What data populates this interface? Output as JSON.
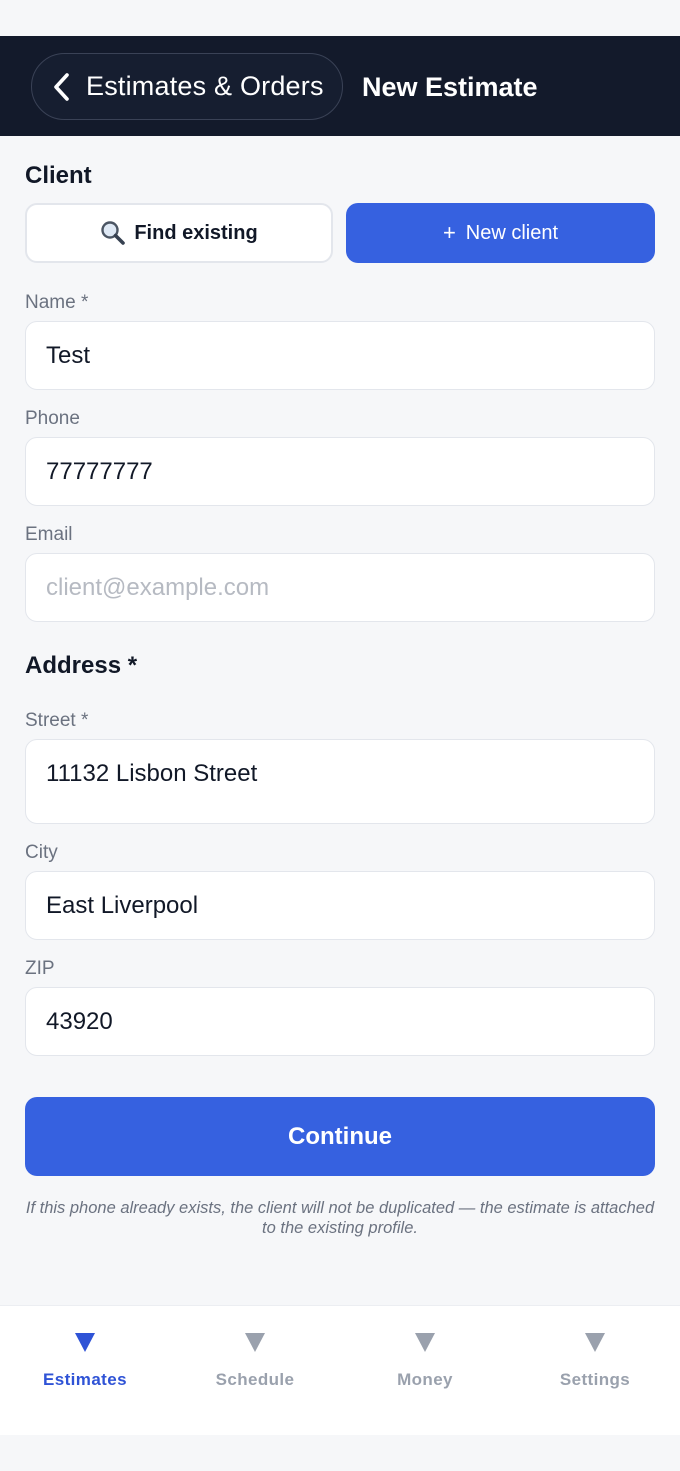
{
  "header": {
    "back_label": "Estimates & Orders",
    "title": "New Estimate"
  },
  "client": {
    "section_title": "Client",
    "find_existing_label": "Find existing",
    "new_client_label": "New client",
    "name_label": "Name *",
    "name_value": "Test",
    "phone_label": "Phone",
    "phone_value": "77777777",
    "email_label": "Email",
    "email_placeholder": "client@example.com"
  },
  "address": {
    "section_title": "Address *",
    "street_label": "Street *",
    "street_value": "11132 Lisbon Street",
    "city_label": "City",
    "city_value": "East Liverpool",
    "zip_label": "ZIP",
    "zip_value": "43920"
  },
  "actions": {
    "continue_label": "Continue",
    "hint": "If this phone already exists, the client will not be duplicated — the estimate is attached to the existing profile."
  },
  "tabs": [
    {
      "label": "Estimates",
      "active": true
    },
    {
      "label": "Schedule",
      "active": false
    },
    {
      "label": "Money",
      "active": false
    },
    {
      "label": "Settings",
      "active": false
    }
  ],
  "colors": {
    "accent": "#3661e0",
    "navbar": "#131a2b",
    "tab_active": "#2f53d6",
    "tab_inactive": "#9aa1ad"
  }
}
